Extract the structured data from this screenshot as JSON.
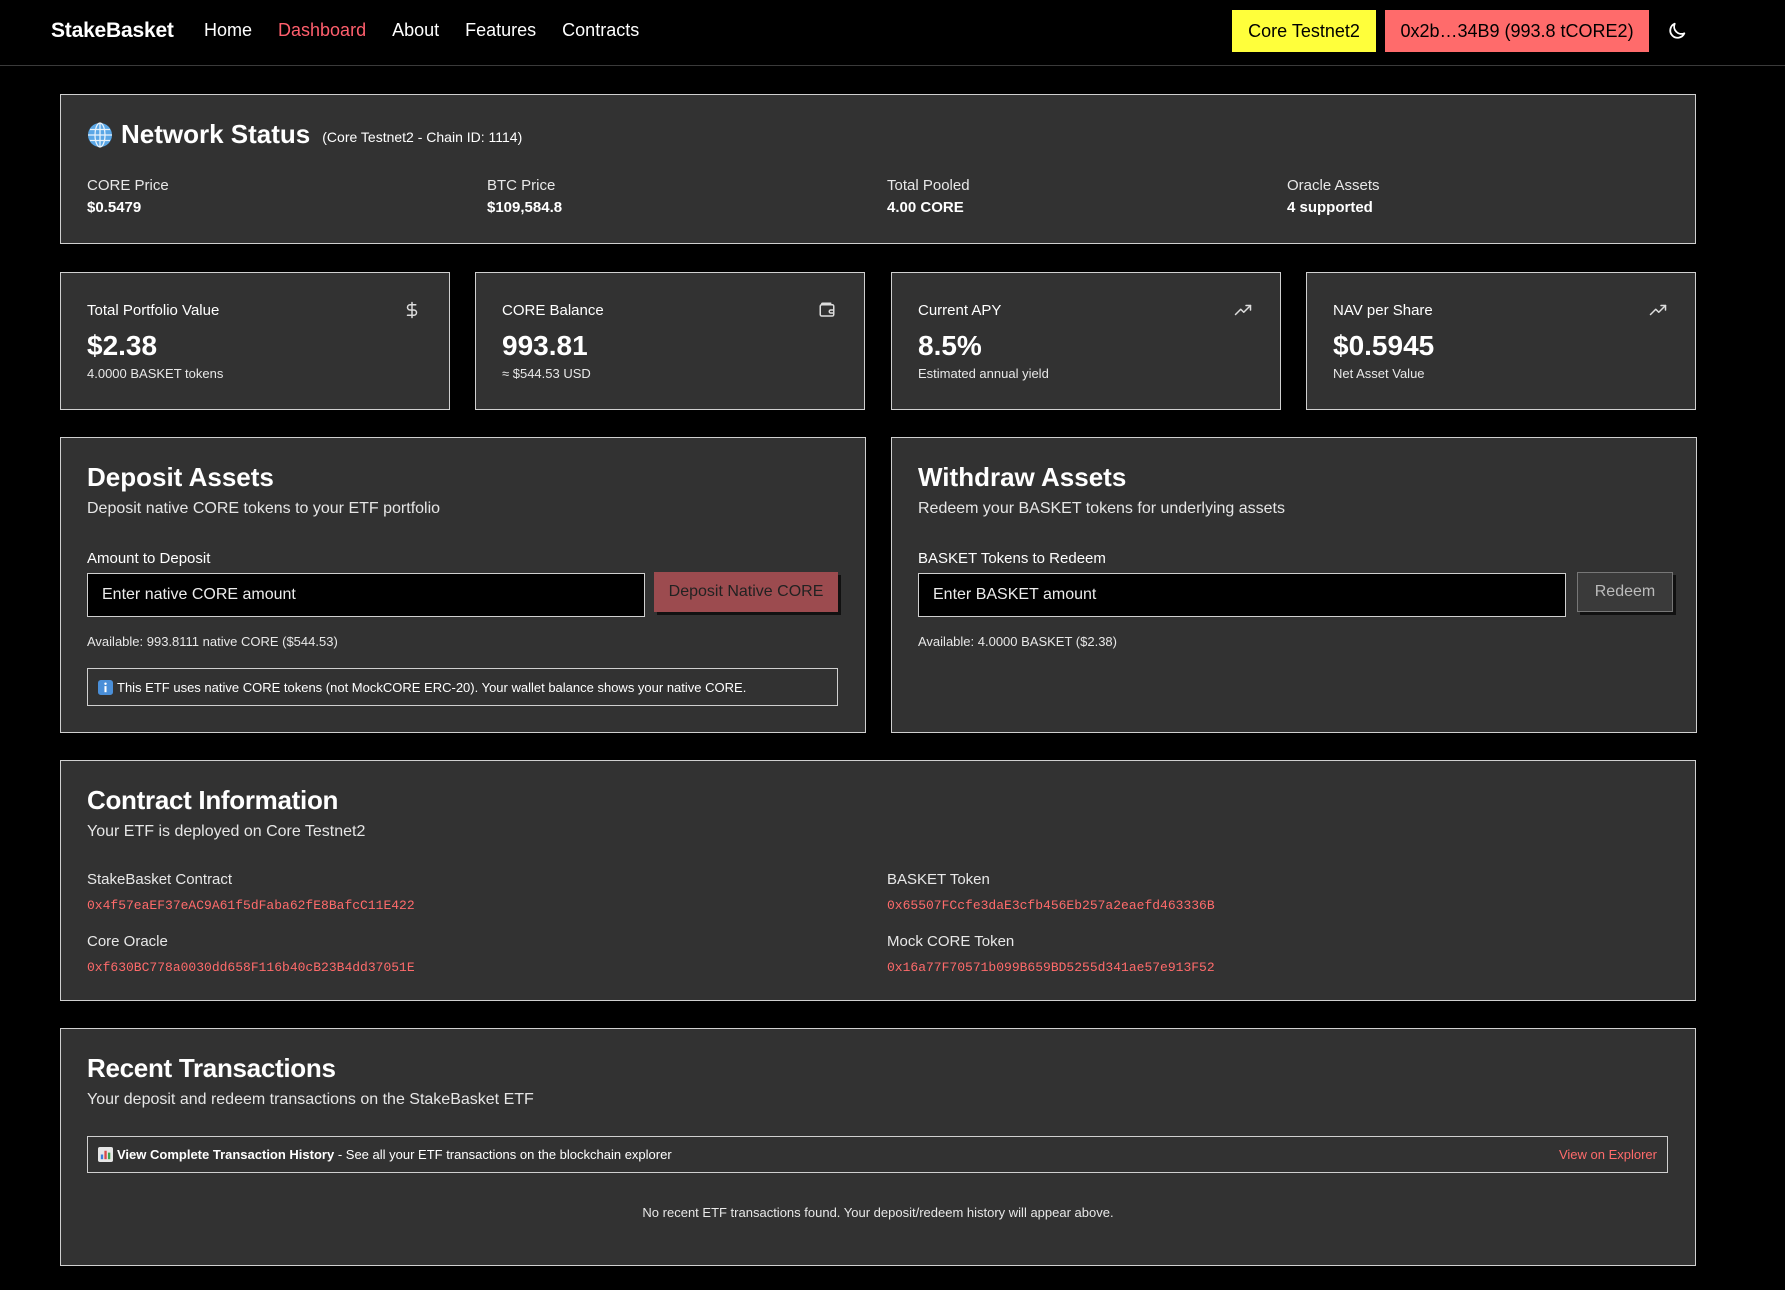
{
  "nav": {
    "brand": "StakeBasket",
    "links": [
      "Home",
      "Dashboard",
      "About",
      "Features",
      "Contracts"
    ],
    "network_button": "Core Testnet2",
    "wallet_button": "0x2b…34B9 (993.8 tCORE2)",
    "colors": {
      "accent": "#ff5f6d",
      "network": "#ffff3b",
      "wallet": "#ff6b6b"
    }
  },
  "network_status": {
    "title": "Network Status",
    "chain": "(Core Testnet2 - Chain ID: 1114)",
    "stats": [
      {
        "label": "CORE Price",
        "value": "$0.5479"
      },
      {
        "label": "BTC Price",
        "value": "$109,584.8"
      },
      {
        "label": "Total Pooled",
        "value": "4.00 CORE"
      },
      {
        "label": "Oracle Assets",
        "value": "4 supported"
      }
    ]
  },
  "stat_cards": [
    {
      "label": "Total Portfolio Value",
      "value": "$2.38",
      "sub": "4.0000 BASKET tokens",
      "icon": "dollar-icon"
    },
    {
      "label": "CORE Balance",
      "value": "993.81",
      "sub": "≈ $544.53 USD",
      "icon": "wallet-icon"
    },
    {
      "label": "Current APY",
      "value": "8.5%",
      "sub": "Estimated annual yield",
      "icon": "trending-up-icon"
    },
    {
      "label": "NAV per Share",
      "value": "$0.5945",
      "sub": "Net Asset Value",
      "icon": "trending-up-icon"
    }
  ],
  "deposit": {
    "title": "Deposit Assets",
    "description": "Deposit native CORE tokens to your ETF portfolio",
    "label": "Amount to Deposit",
    "placeholder": "Enter native CORE amount",
    "button": "Deposit Native CORE",
    "available": "Available: 993.8111 native CORE ($544.53)",
    "note": "This ETF uses native CORE tokens (not MockCORE ERC-20). Your wallet balance shows your native CORE."
  },
  "withdraw": {
    "title": "Withdraw Assets",
    "description": "Redeem your BASKET tokens for underlying assets",
    "label": "BASKET Tokens to Redeem",
    "placeholder": "Enter BASKET amount",
    "button": "Redeem",
    "available": "Available: 4.0000 BASKET ($2.38)"
  },
  "contract_info": {
    "title": "Contract Information",
    "description": "Your ETF is deployed on Core Testnet2",
    "items": [
      {
        "label": "StakeBasket Contract",
        "address": "0x4f57eaEF37eAC9A61f5dFaba62fE8BafcC11E422"
      },
      {
        "label": "BASKET Token",
        "address": "0x65507FCcfe3daE3cfb456Eb257a2eaefd463336B"
      },
      {
        "label": "Core Oracle",
        "address": "0xf630BC778a0030dd658F116b40cB23B4dd37051E"
      },
      {
        "label": "Mock CORE Token",
        "address": "0x16a77F70571b099B659BD5255d341ae57e913F52"
      }
    ]
  },
  "recent_transactions": {
    "title": "Recent Transactions",
    "description": "Your deposit and redeem transactions on the StakeBasket ETF",
    "history_bold": "View Complete Transaction History",
    "history_rest": " - See all your ETF transactions on the blockchain explorer",
    "explorer_link": "View on Explorer",
    "empty": "No recent ETF transactions found. Your deposit/redeem history will appear above."
  }
}
